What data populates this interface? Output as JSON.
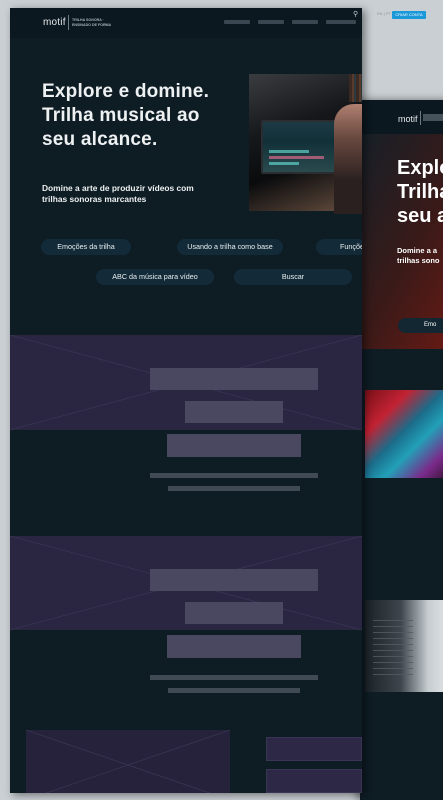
{
  "nav": {
    "logo": "motif",
    "tagline": "TRILHA SONORA · ENSINADO DE FORMA",
    "search_icon": "search-icon",
    "lang": "EN | PT",
    "cta": "CRIAR CONTA"
  },
  "hero": {
    "title": "Explore e domine.\nTrilha musical ao\nseu alcance.",
    "subtitle": "Domine a arte de produzir vídeos com\ntrilhas sonoras marcantes"
  },
  "topics": [
    "Emoções da trilha",
    "Usando a trilha como base",
    "Funções",
    "ABC da música para vídeo",
    "Buscar"
  ],
  "mockup_right": {
    "logo": "motif",
    "title": "Explo\nTrilha\nseu a",
    "subtitle": "Domine a a\ntrilhas sono",
    "pill": "Emo"
  },
  "colors": {
    "page_bg": "#0e1c24",
    "placeholder": "#2a2540",
    "accent": "#1b98d8"
  }
}
